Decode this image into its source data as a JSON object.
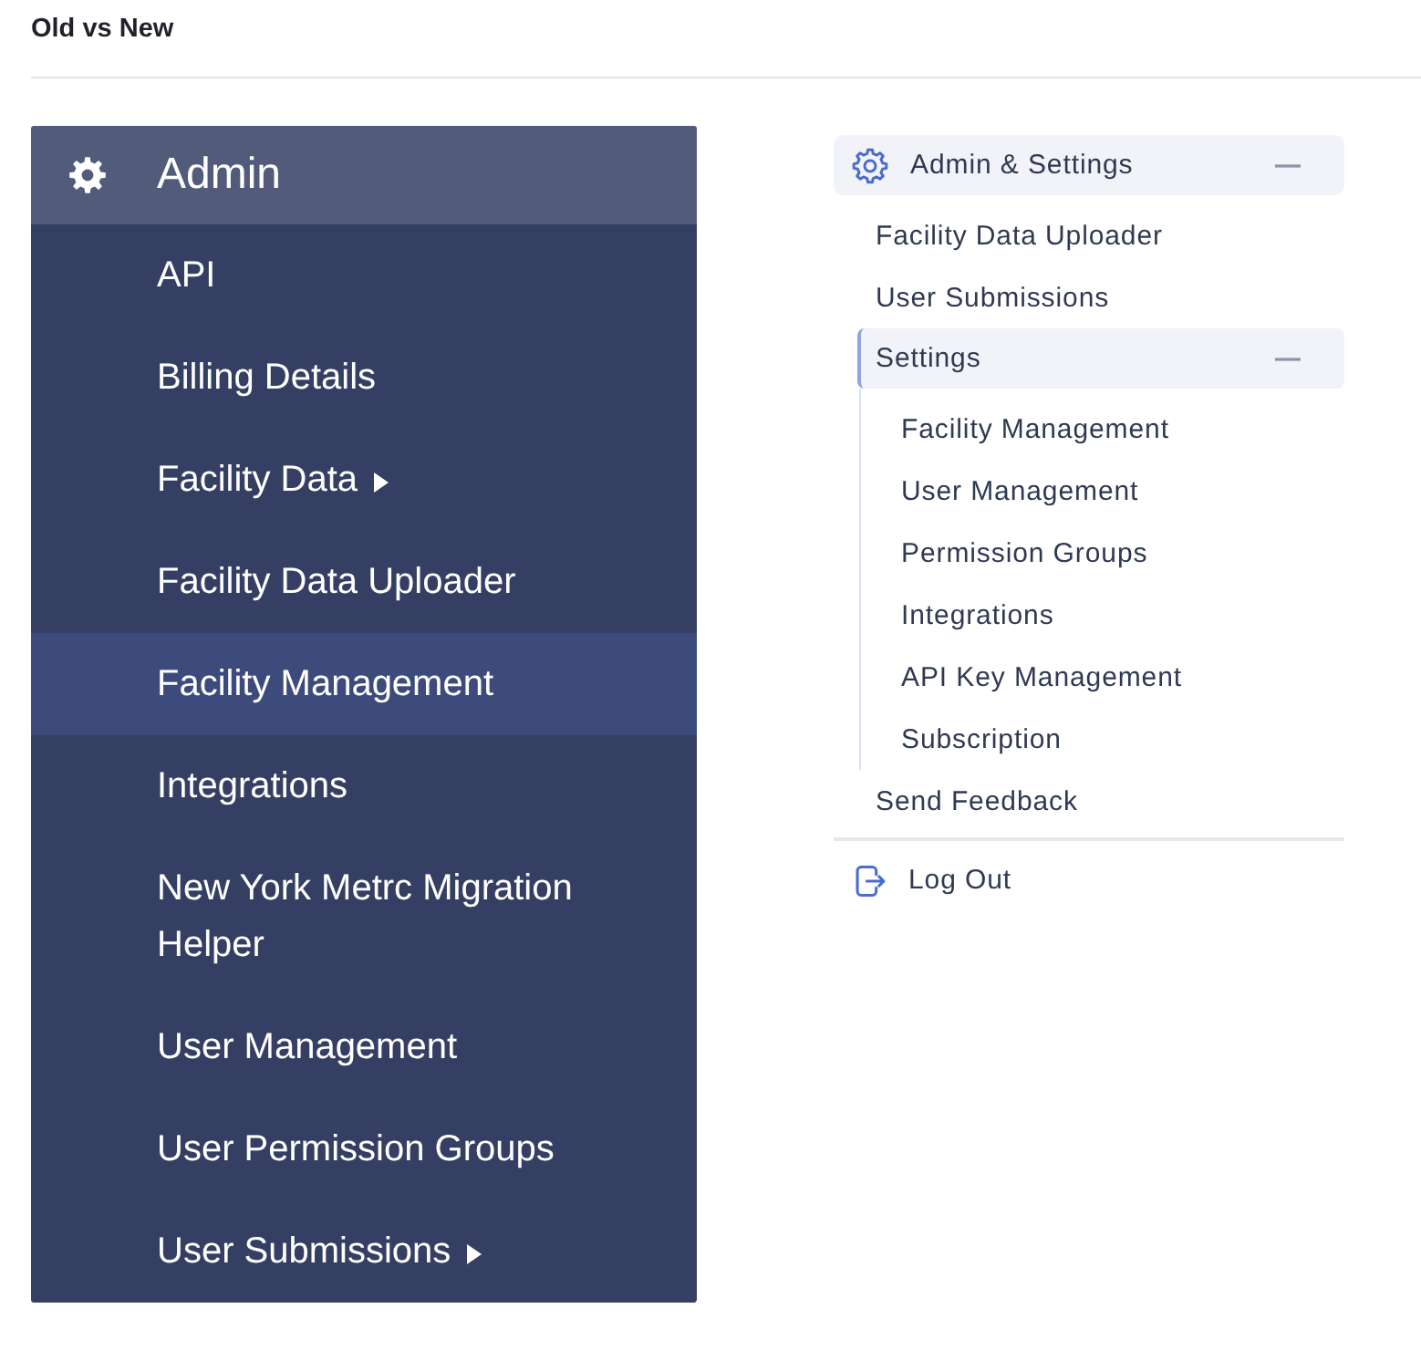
{
  "page": {
    "title": "Old vs New"
  },
  "old_menu": {
    "header": {
      "label": "Admin"
    },
    "items": [
      {
        "label": "API",
        "selected": false,
        "submenu": false
      },
      {
        "label": "Billing Details",
        "selected": false,
        "submenu": false
      },
      {
        "label": "Facility Data",
        "selected": false,
        "submenu": true
      },
      {
        "label": "Facility Data Uploader",
        "selected": false,
        "submenu": false
      },
      {
        "label": "Facility Management",
        "selected": true,
        "submenu": false
      },
      {
        "label": "Integrations",
        "selected": false,
        "submenu": false
      },
      {
        "label": "New York Metrc Migration Helper",
        "selected": false,
        "submenu": false
      },
      {
        "label": "User Management",
        "selected": false,
        "submenu": false
      },
      {
        "label": "User Permission Groups",
        "selected": false,
        "submenu": false
      },
      {
        "label": "User Submissions",
        "selected": false,
        "submenu": true
      }
    ]
  },
  "new_menu": {
    "section": {
      "label": "Admin & Settings",
      "expanded": true
    },
    "items": [
      {
        "kind": "link",
        "label": "Facility Data Uploader"
      },
      {
        "kind": "link",
        "label": "User Submissions"
      },
      {
        "kind": "group",
        "label": "Settings",
        "expanded": true,
        "children": [
          {
            "label": "Facility Management"
          },
          {
            "label": "User Management"
          },
          {
            "label": "Permission Groups"
          },
          {
            "label": "Integrations"
          },
          {
            "label": "API Key Management"
          },
          {
            "label": "Subscription"
          }
        ]
      },
      {
        "kind": "link",
        "label": "Send Feedback"
      }
    ],
    "logout": {
      "label": "Log Out"
    }
  }
}
